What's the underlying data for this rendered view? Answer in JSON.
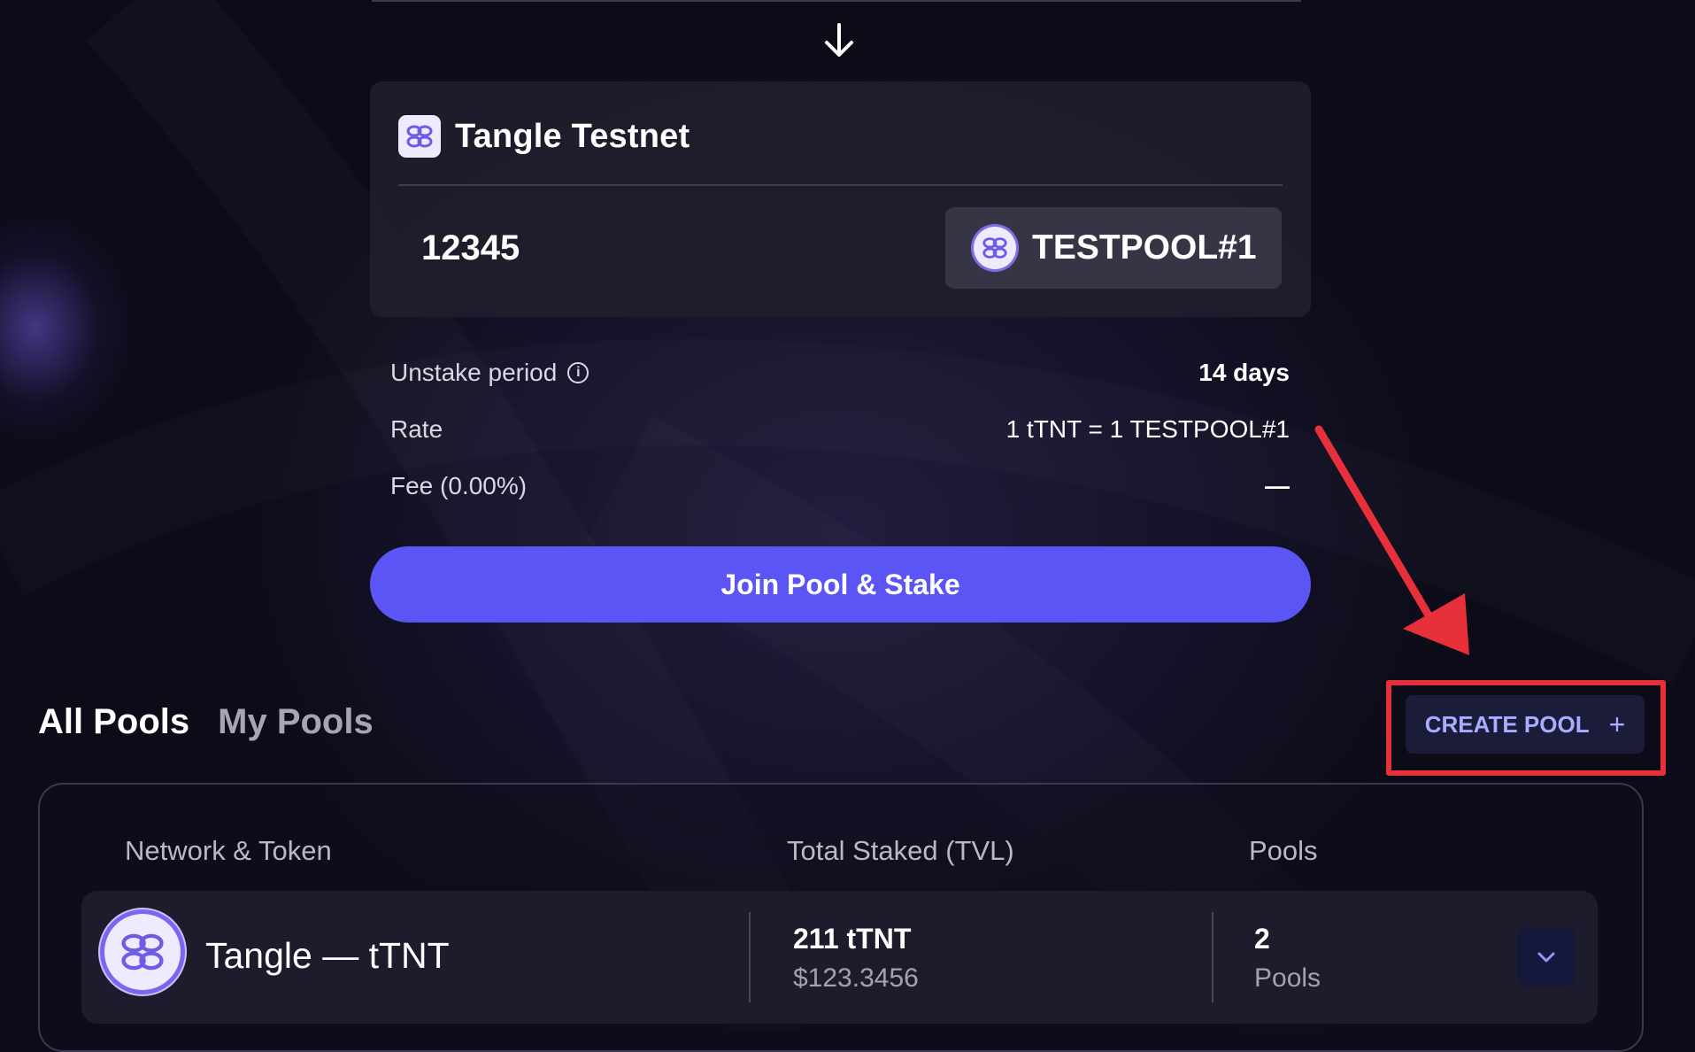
{
  "network_card": {
    "network_name": "Tangle Testnet",
    "amount": "12345",
    "pool_name": "TESTPOOL#1"
  },
  "details": [
    {
      "label": "Unstake period",
      "value": "14 days",
      "has_info_icon": true
    },
    {
      "label": "Rate",
      "value": "1 tTNT = 1 TESTPOOL#1",
      "has_info_icon": false
    },
    {
      "label": "Fee (0.00%)",
      "value": "—",
      "has_info_icon": false
    }
  ],
  "join_button": {
    "label": "Join Pool & Stake"
  },
  "pool_tabs": [
    {
      "label": "All Pools",
      "active": true
    },
    {
      "label": "My Pools",
      "active": false
    }
  ],
  "create_pool_button": {
    "label": "CREATE POOL",
    "icon": "plus-icon"
  },
  "table": {
    "headers": {
      "network_token": "Network & Token",
      "tvl": "Total Staked (TVL)",
      "pools": "Pools"
    },
    "rows": [
      {
        "token": "Tangle — tTNT",
        "tvl_amount": "211 tTNT",
        "tvl_usd": "$123.3456",
        "pool_count": "2",
        "pool_count_label": "Pools"
      }
    ]
  },
  "colors": {
    "primary": "#5a55f4",
    "annotation_red": "#e8303a",
    "create_pool_text": "#a9adff",
    "background": "#0b0a14"
  }
}
